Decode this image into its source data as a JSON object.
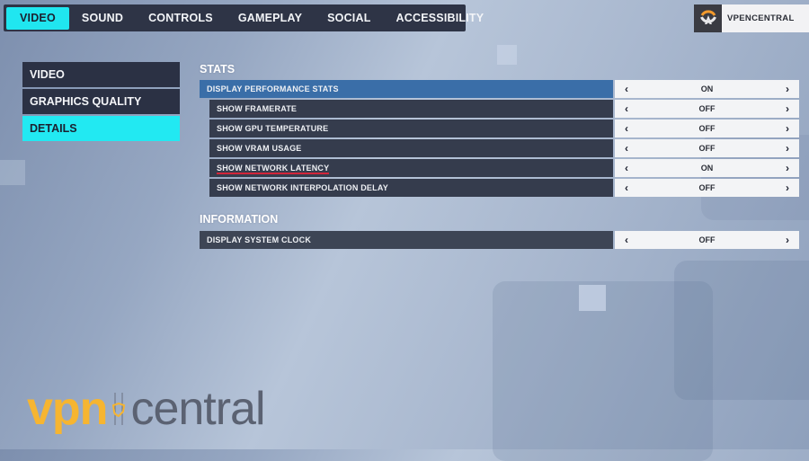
{
  "top_nav": {
    "tabs": [
      {
        "label": "VIDEO",
        "active": true
      },
      {
        "label": "SOUND",
        "active": false
      },
      {
        "label": "CONTROLS",
        "active": false
      },
      {
        "label": "GAMEPLAY",
        "active": false
      },
      {
        "label": "SOCIAL",
        "active": false
      },
      {
        "label": "ACCESSIBILITY",
        "active": false
      }
    ]
  },
  "profile": {
    "name": "VPENCENTRAL",
    "icon": "overwatch-logo-icon"
  },
  "side_menu": {
    "items": [
      {
        "label": "VIDEO",
        "active": false
      },
      {
        "label": "GRAPHICS QUALITY",
        "active": false
      },
      {
        "label": "DETAILS",
        "active": true
      }
    ]
  },
  "sections": {
    "stats": {
      "title": "STATS",
      "rows": [
        {
          "label": "DISPLAY PERFORMANCE STATS",
          "value": "ON"
        },
        {
          "label": "SHOW FRAMERATE",
          "value": "OFF"
        },
        {
          "label": "SHOW GPU TEMPERATURE",
          "value": "OFF"
        },
        {
          "label": "SHOW VRAM USAGE",
          "value": "OFF"
        },
        {
          "label": "SHOW NETWORK LATENCY",
          "value": "ON"
        },
        {
          "label": "SHOW NETWORK INTERPOLATION DELAY",
          "value": "OFF"
        }
      ]
    },
    "information": {
      "title": "INFORMATION",
      "rows": [
        {
          "label": "DISPLAY SYSTEM CLOCK",
          "value": "OFF"
        }
      ]
    }
  },
  "arrows": {
    "left": "‹",
    "right": "›"
  },
  "watermark": {
    "part1": "vpn",
    "part2": "central"
  },
  "colors": {
    "accent": "#22e9f2",
    "highlight_row": "#3a6ea8",
    "underline": "#d2253a",
    "watermark_yellow": "#f6b531"
  }
}
